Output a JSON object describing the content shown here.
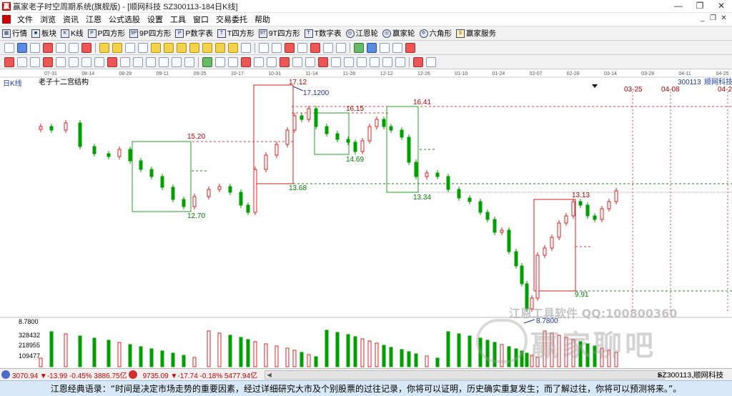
{
  "window": {
    "title": "赢家老子时空周期系统(旗舰版) - [顺网科技  SZ300113-184日K线]"
  },
  "menu": [
    "文件",
    "浏览",
    "资讯",
    "江恩",
    "公式选股",
    "设置",
    "工具",
    "窗口",
    "交易委托",
    "帮助"
  ],
  "toolbar1": [
    {
      "label": "行情",
      "icon": "grid-icon"
    },
    {
      "label": "板块",
      "icon": "blocks-icon"
    },
    {
      "label": "K线",
      "icon": "kline-icon"
    },
    {
      "label": "P四方形",
      "icon": "p-square-icon"
    },
    {
      "label": "9P四方形",
      "icon": "9p-square-icon"
    },
    {
      "label": "P数字表",
      "icon": "p-table-icon"
    },
    {
      "label": "T四方形",
      "icon": "t-square-icon"
    },
    {
      "label": "9T四方形",
      "icon": "9t-square-icon"
    },
    {
      "label": "T数字表",
      "icon": "t-table-icon"
    },
    {
      "label": "江恩轮",
      "icon": "gann-wheel-icon"
    },
    {
      "label": "赢家轮",
      "icon": "winner-wheel-icon"
    },
    {
      "label": "六角形",
      "icon": "hexagon-icon"
    },
    {
      "label": "赢家服务",
      "icon": "dollar-icon"
    }
  ],
  "chart": {
    "period_label": "日K线",
    "indicator_name": "老子十二宫结构",
    "stock_code": "300113",
    "stock_name": "顺网科技",
    "date_ticks": [
      "07-31",
      "08-14",
      "08-28",
      "09-11",
      "09-25",
      "10-17",
      "10-31",
      "11-14",
      "11-28",
      "12-12",
      "12-26",
      "01-10",
      "01-24",
      "02-07",
      "02-28",
      "03-14",
      "03-28",
      "04-11",
      "04-25"
    ],
    "future_dates": [
      "03-25",
      "04-08",
      "04-2"
    ],
    "price_labels": [
      {
        "text": "17.12",
        "color": "#c00000"
      },
      {
        "text": "17.1200",
        "color": "#2030a0"
      },
      {
        "text": "16.41",
        "color": "#c00000"
      },
      {
        "text": "16.15",
        "color": "#c00000"
      },
      {
        "text": "15.20",
        "color": "#c00000"
      },
      {
        "text": "14.69",
        "color": "#008000"
      },
      {
        "text": "13.68",
        "color": "#008000"
      },
      {
        "text": "13.34",
        "color": "#008000"
      },
      {
        "text": "13.13",
        "color": "#c00000"
      },
      {
        "text": "12.70",
        "color": "#008000"
      },
      {
        "text": "9.91",
        "color": "#008000"
      },
      {
        "text": "8.7800",
        "color": "#2030a0"
      }
    ],
    "volume_axis": [
      "8.7800",
      "328432",
      "218955",
      "109477"
    ],
    "colors": {
      "up": "#e02020",
      "down": "#00a000",
      "box_red": "#d02020",
      "box_green": "#20a020",
      "dash_red": "#e04040",
      "dash_green": "#208020"
    }
  },
  "status": {
    "sh_index": "3070.94 ▼-13.99 -0.45% 3886.75亿",
    "sz_index": "9735.09 ▼-17.74 -0.18% 5477.94亿",
    "code_name": "SZ300113,顺网科技"
  },
  "watermark": {
    "line1": "江恩工具软件  QQ:100800360",
    "line2": "赢家聊吧",
    "line3": "jiaoba.yzrf.com"
  },
  "quote": "江恩经典语录：“时间是决定市场走势的重要因素，经过详细研究大市及个别股票的过往记录，你将可以证明，历史确实重复发生；而了解过往，你将可以预测将来。”。"
}
